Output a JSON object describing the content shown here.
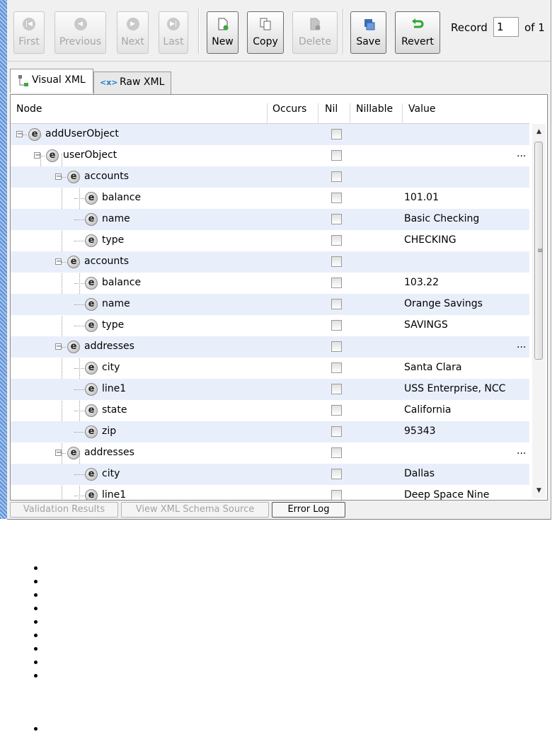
{
  "toolbar": {
    "first": "First",
    "previous": "Previous",
    "next": "Next",
    "last": "Last",
    "new": "New",
    "copy": "Copy",
    "delete": "Delete",
    "save": "Save",
    "revert": "Revert",
    "record_label": "Record",
    "record_value": "1",
    "record_of": "of 1"
  },
  "tabs": {
    "visual": "Visual XML",
    "raw": "Raw XML",
    "raw_icon_text": "<x>"
  },
  "columns": {
    "node": "Node",
    "occurs": "Occurs",
    "nil": "Nil",
    "nillable": "Nillable",
    "value": "Value"
  },
  "rows": [
    {
      "name": "addUserObject",
      "value": ""
    },
    {
      "name": "userObject",
      "value": ""
    },
    {
      "name": "accounts",
      "value": ""
    },
    {
      "name": "balance",
      "value": "101.01"
    },
    {
      "name": "name",
      "value": "Basic Checking"
    },
    {
      "name": "type",
      "value": "CHECKING"
    },
    {
      "name": "accounts",
      "value": ""
    },
    {
      "name": "balance",
      "value": "103.22"
    },
    {
      "name": "name",
      "value": "Orange Savings"
    },
    {
      "name": "type",
      "value": "SAVINGS"
    },
    {
      "name": "addresses",
      "value": ""
    },
    {
      "name": "city",
      "value": "Santa Clara"
    },
    {
      "name": "line1",
      "value": "USS Enterprise, NCC"
    },
    {
      "name": "state",
      "value": "California"
    },
    {
      "name": "zip",
      "value": "95343"
    },
    {
      "name": "addresses",
      "value": ""
    },
    {
      "name": "city",
      "value": "Dallas"
    },
    {
      "name": "line1",
      "value": "Deep Space Nine"
    }
  ],
  "ellipsis": "...",
  "bottom_tabs": {
    "validation": "Validation Results",
    "schema": "View XML Schema Source",
    "errorlog": "Error Log"
  },
  "icon_letter": "e",
  "colors": {
    "row_alt": "#e9effa",
    "stripe": "#5b8fd6"
  }
}
